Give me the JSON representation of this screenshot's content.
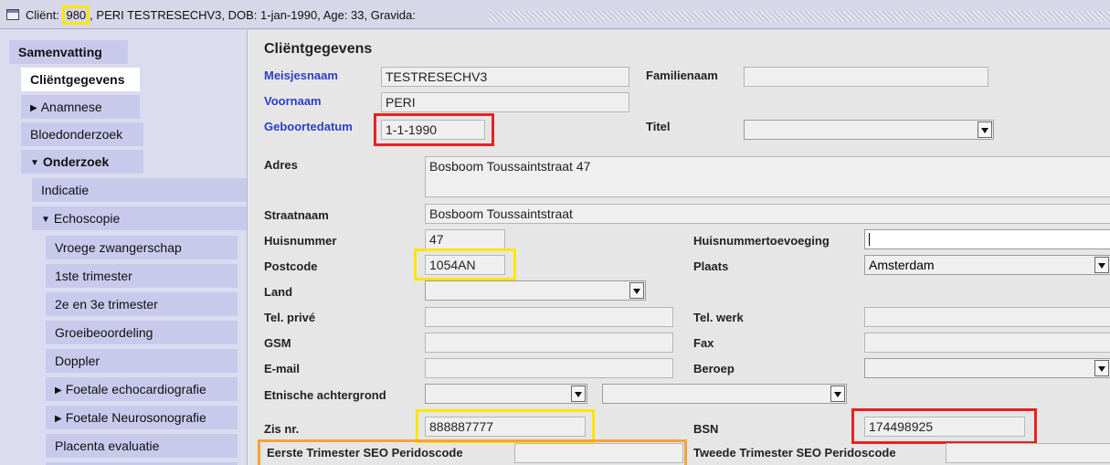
{
  "window": {
    "title_prefix": "Cliënt: ",
    "client_number": "980",
    "title_rest": ", PERI TESTRESECHV3, DOB: 1-jan-1990, Age: 33, Gravida:"
  },
  "sidebar": {
    "items": [
      {
        "label": "Samenvatting"
      },
      {
        "label": "Cliëntgegevens"
      },
      {
        "label": "Anamnese"
      },
      {
        "label": "Bloedonderzoek"
      },
      {
        "label": "Onderzoek"
      },
      {
        "label": "Indicatie"
      },
      {
        "label": "Echoscopie"
      },
      {
        "label": "Vroege zwangerschap"
      },
      {
        "label": "1ste trimester"
      },
      {
        "label": "2e en 3e trimester"
      },
      {
        "label": "Groeibeoordeling"
      },
      {
        "label": "Doppler"
      },
      {
        "label": "Foetale echocardiografie"
      },
      {
        "label": "Foetale Neurosonografie"
      },
      {
        "label": "Placenta evaluatie"
      }
    ]
  },
  "form": {
    "title": "Cliëntgegevens",
    "meisjesnaam": {
      "label": "Meisjesnaam",
      "value": "TESTRESECHV3"
    },
    "familienaam": {
      "label": "Familienaam",
      "value": ""
    },
    "voornaam": {
      "label": "Voornaam",
      "value": "PERI"
    },
    "geboortedatum": {
      "label": "Geboortedatum",
      "value": "1-1-1990"
    },
    "titel": {
      "label": "Titel",
      "value": ""
    },
    "adres": {
      "label": "Adres",
      "value": "Bosboom Toussaintstraat 47"
    },
    "straatnaam": {
      "label": "Straatnaam",
      "value": "Bosboom Toussaintstraat"
    },
    "huisnummer": {
      "label": "Huisnummer",
      "value": "47"
    },
    "huisnummertoevoeging": {
      "label": "Huisnummertoevoeging",
      "value": ""
    },
    "postcode": {
      "label": "Postcode",
      "value": "1054AN"
    },
    "plaats": {
      "label": "Plaats",
      "value": "Amsterdam"
    },
    "land": {
      "label": "Land",
      "value": ""
    },
    "tel_prive": {
      "label": "Tel. privé",
      "value": ""
    },
    "tel_werk": {
      "label": "Tel. werk",
      "value": ""
    },
    "gsm": {
      "label": "GSM",
      "value": ""
    },
    "fax": {
      "label": "Fax",
      "value": ""
    },
    "email": {
      "label": "E-mail",
      "value": ""
    },
    "beroep": {
      "label": "Beroep",
      "value": ""
    },
    "etnische": {
      "label": "Etnische achtergrond",
      "value": "",
      "value2": ""
    },
    "zis": {
      "label": "Zis nr.",
      "value": "888887777"
    },
    "bsn": {
      "label": "BSN",
      "value": "174498925"
    },
    "eerste_seo": {
      "label": "Eerste Trimester SEO Peridoscode",
      "value": ""
    },
    "tweede_seo": {
      "label": "Tweede Trimester SEO Peridoscode",
      "value": ""
    }
  },
  "colors": {
    "highlight_red": "#e8211d",
    "highlight_yellow": "#ffe600",
    "highlight_orange": "#f5a33a",
    "label_blue": "#2c3ec8"
  }
}
